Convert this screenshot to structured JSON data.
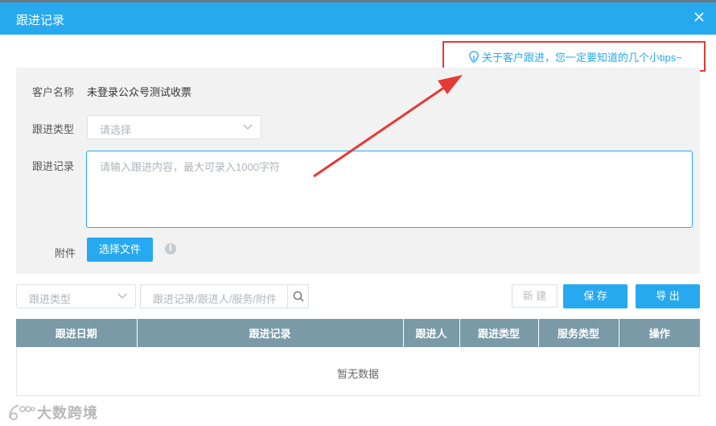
{
  "dialog": {
    "title": "跟进记录"
  },
  "tips": {
    "text": "关于客户跟进，您一定要知道的几个小tips~"
  },
  "form": {
    "customer_label": "客户名称",
    "customer_value": "未登录公众号测试收票",
    "type_label": "跟进类型",
    "type_placeholder": "请选择",
    "record_label": "跟进记录",
    "record_placeholder": "请输入跟进内容，最大可录入1000字符",
    "attachment_label": "附件",
    "choose_file_label": "选择文件"
  },
  "toolbar": {
    "filter_type_placeholder": "跟进类型",
    "search_placeholder": "跟进记录/跟进人/服务/附件",
    "new_label": "新 建",
    "save_label": "保 存",
    "export_label": "导 出"
  },
  "table": {
    "columns": [
      "跟进日期",
      "跟进记录",
      "跟进人",
      "跟进类型",
      "服务类型",
      "操作"
    ],
    "empty_text": "暂无数据"
  },
  "watermark": {
    "text": "大数跨境"
  },
  "colors": {
    "primary": "#27a9f0",
    "header_bg": "#7a9aa8",
    "highlight": "#e53935"
  }
}
